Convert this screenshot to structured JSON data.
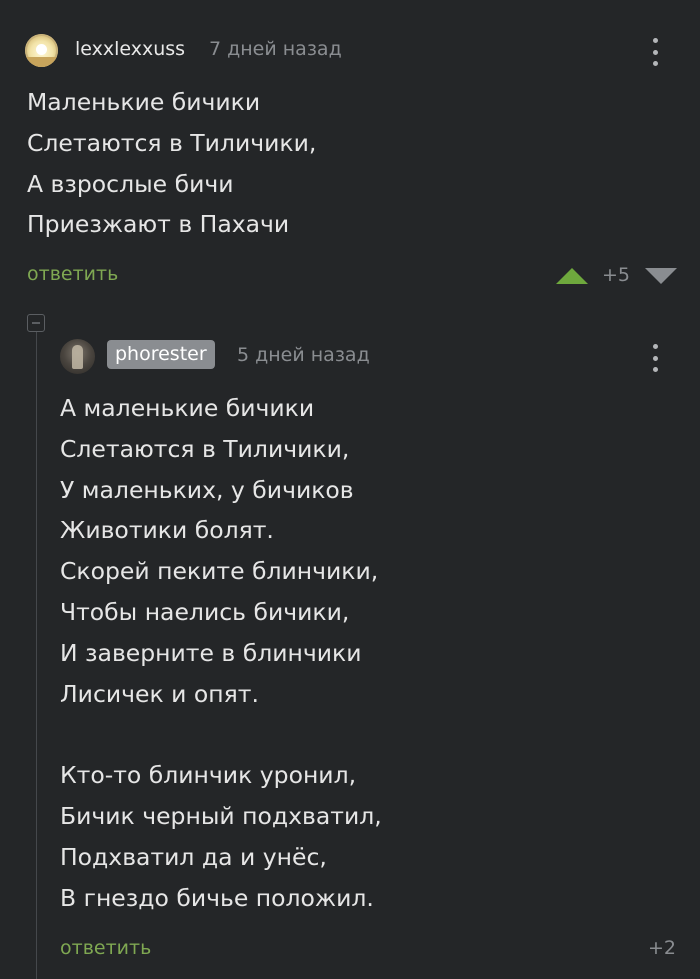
{
  "comments": [
    {
      "username": "lexxlexxuss",
      "time": "7 дней назад",
      "lines": [
        "Маленькие бичики",
        "Слетаются в Тиличики,",
        "А взрослые бичи",
        "Приезжают в Пахачи"
      ],
      "reply_label": "ответить",
      "score": "+5",
      "icons": {
        "upvote": "triangle-up-icon",
        "downvote": "triangle-down-icon",
        "menu": "kebab-menu-icon"
      },
      "colors": {
        "upvote_active": "#6ea83d"
      }
    },
    {
      "username": "phorester",
      "time": "5 дней назад",
      "lines": [
        "А маленькие бичики",
        "Слетаются в Тиличики,",
        "У маленьких, у бичиков",
        "Животики болят.",
        "Скорей пеките блинчики,",
        "Чтобы наелись бичики,",
        "И заверните в блинчики",
        "Лисичек и опят.",
        "",
        "Кто-то блинчик уронил,",
        "Бичик черный подхватил,",
        "Подхватил да и унёс,",
        "В гнездо бичье положил."
      ],
      "reply_label": "ответить",
      "score": "+2",
      "icons": {
        "menu": "kebab-menu-icon",
        "collapse": "collapse-thread-icon"
      }
    }
  ],
  "colors": {
    "background": "#242628",
    "reply_link": "#7fa852",
    "muted_text": "#8a8d91",
    "author_badge_bg": "#8a8d91"
  }
}
